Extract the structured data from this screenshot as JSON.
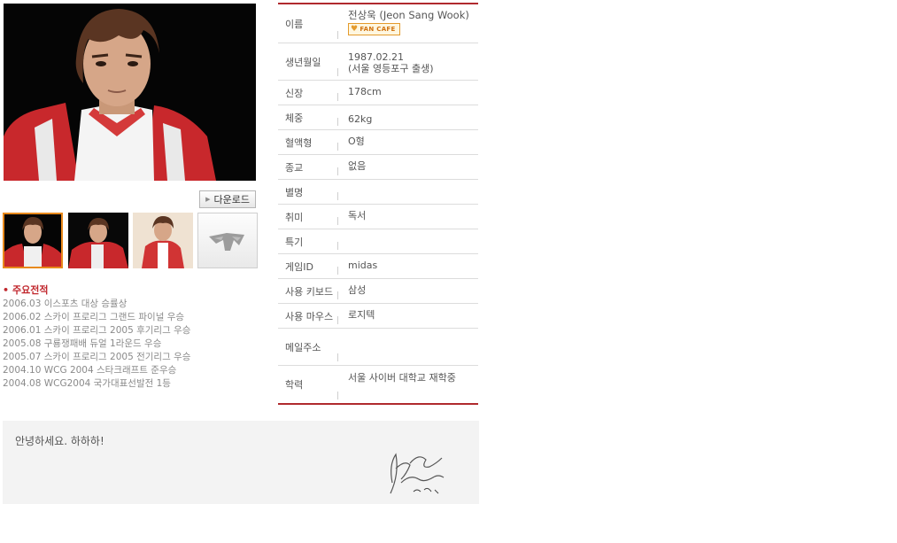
{
  "download": {
    "label": "다운로드"
  },
  "records": {
    "title": "주요전적",
    "items": [
      "2006.03 이스포츠 대상 승률상",
      "2006.02 스카이 프로리그 그랜드 파이널 우승",
      "2006.01 스카이 프로리그 2005 후기리그 우승",
      "2005.08 구룡쟁패배 듀얼 1라운드 우승",
      "2005.07 스카이 프로리그 2005 전기리그 우승",
      "2004.10 WCG 2004 스타크래프트 준우승",
      "2004.08 WCG2004 국가대표선발전 1등"
    ]
  },
  "profile": {
    "name_label": "이름",
    "name_value": "전상욱 (Jeon Sang Wook)",
    "fan_cafe": "FAN CAFE",
    "birth_label": "생년월일",
    "birth_line1": "1987.02.21",
    "birth_line2": "(서울 영등포구 출생)",
    "height_label": "신장",
    "height_value": "178cm",
    "weight_label": "체중",
    "weight_value": "62kg",
    "blood_label": "혈액형",
    "blood_value": "O형",
    "religion_label": "종교",
    "religion_value": "없음",
    "nickname_label": "별명",
    "nickname_value": "",
    "hobby_label": "취미",
    "hobby_value": "독서",
    "talent_label": "특기",
    "talent_value": "",
    "gameid_label": "게임ID",
    "gameid_value": "midas",
    "keyboard_label": "사용 키보드",
    "keyboard_value": "삼성",
    "mouse_label": "사용 마우스",
    "mouse_value": "로지텍",
    "email_label": "메일주소",
    "email_value": "",
    "education_label": "학력",
    "education_value": "서울 사이버 대학교 재학중"
  },
  "message": {
    "text": "안녕하세요. 하하하!"
  },
  "colors": {
    "accent": "#b02a2e",
    "selected_border": "#e8891c"
  }
}
